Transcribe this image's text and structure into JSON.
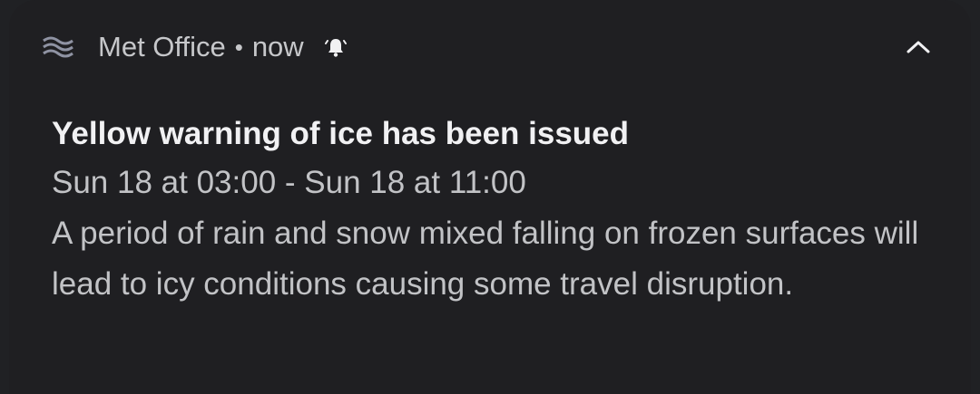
{
  "notification": {
    "app_name": "Met Office",
    "separator": "•",
    "time": "now",
    "app_icon": "met-office-waves-icon",
    "alert_icon": "bell-ringing-icon",
    "expand_icon": "chevron-up-icon",
    "title": "Yellow warning of ice has been issued",
    "time_range": "Sun 18 at 03:00 - Sun 18 at 11:00",
    "body": "A period of rain and snow mixed falling on frozen surfaces will lead to icy conditions causing some travel disruption."
  },
  "colors": {
    "background": "#1f1f22",
    "title": "#f1f1f3",
    "text": "#c2c3c6",
    "icon": "#8f93a3"
  }
}
